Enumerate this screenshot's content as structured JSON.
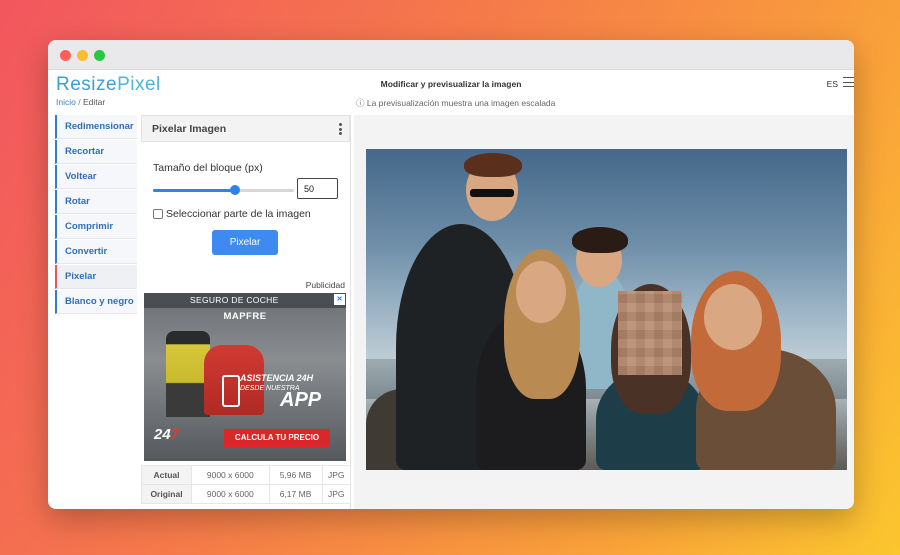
{
  "app": {
    "logo_part1": "Resize",
    "logo_part2": "Pixel",
    "header_title": "Modificar y previsualizar la imagen",
    "language": "ES",
    "preview_note": "ⓘ La previsualización muestra una imagen escalada"
  },
  "breadcrumb": {
    "home": "Inicio",
    "separator": "/",
    "current": "Editar"
  },
  "sidebar": {
    "items": [
      {
        "label": "Redimensionar"
      },
      {
        "label": "Recortar"
      },
      {
        "label": "Voltear"
      },
      {
        "label": "Rotar"
      },
      {
        "label": "Comprimir"
      },
      {
        "label": "Convertir"
      },
      {
        "label": "Pixelar",
        "active": true
      },
      {
        "label": "Blanco y negro"
      }
    ]
  },
  "panel": {
    "title": "Pixelar Imagen",
    "block_size_label": "Tamaño del bloque (px)",
    "block_size_value": "50",
    "slider_fraction": 0.58,
    "select_part_label": "Seleccionar parte de la imagen",
    "select_part_checked": false,
    "action_button": "Pixelar"
  },
  "ad": {
    "label": "Publicidad",
    "top_text": "SEGURO DE COCHE",
    "brand": "MAPFRE",
    "line1": "ASISTENCIA 24H",
    "line2": "DESDE NUESTRA",
    "line3": "APP",
    "badge_24": "24",
    "badge_7": "7",
    "cta": "CALCULA TU PRECIO",
    "close_icon": "ad-choices-icon"
  },
  "file_info": {
    "rows": [
      {
        "label": "Actual",
        "dimensions": "9000 x 6000",
        "size": "5,96 MB",
        "format": "JPG"
      },
      {
        "label": "Original",
        "dimensions": "9000 x 6000",
        "size": "6,17 MB",
        "format": "JPG"
      }
    ]
  },
  "colors": {
    "accent": "#3d8bf0",
    "active_marker": "#e05a5a",
    "sidebar_marker": "#2f7fd1"
  }
}
